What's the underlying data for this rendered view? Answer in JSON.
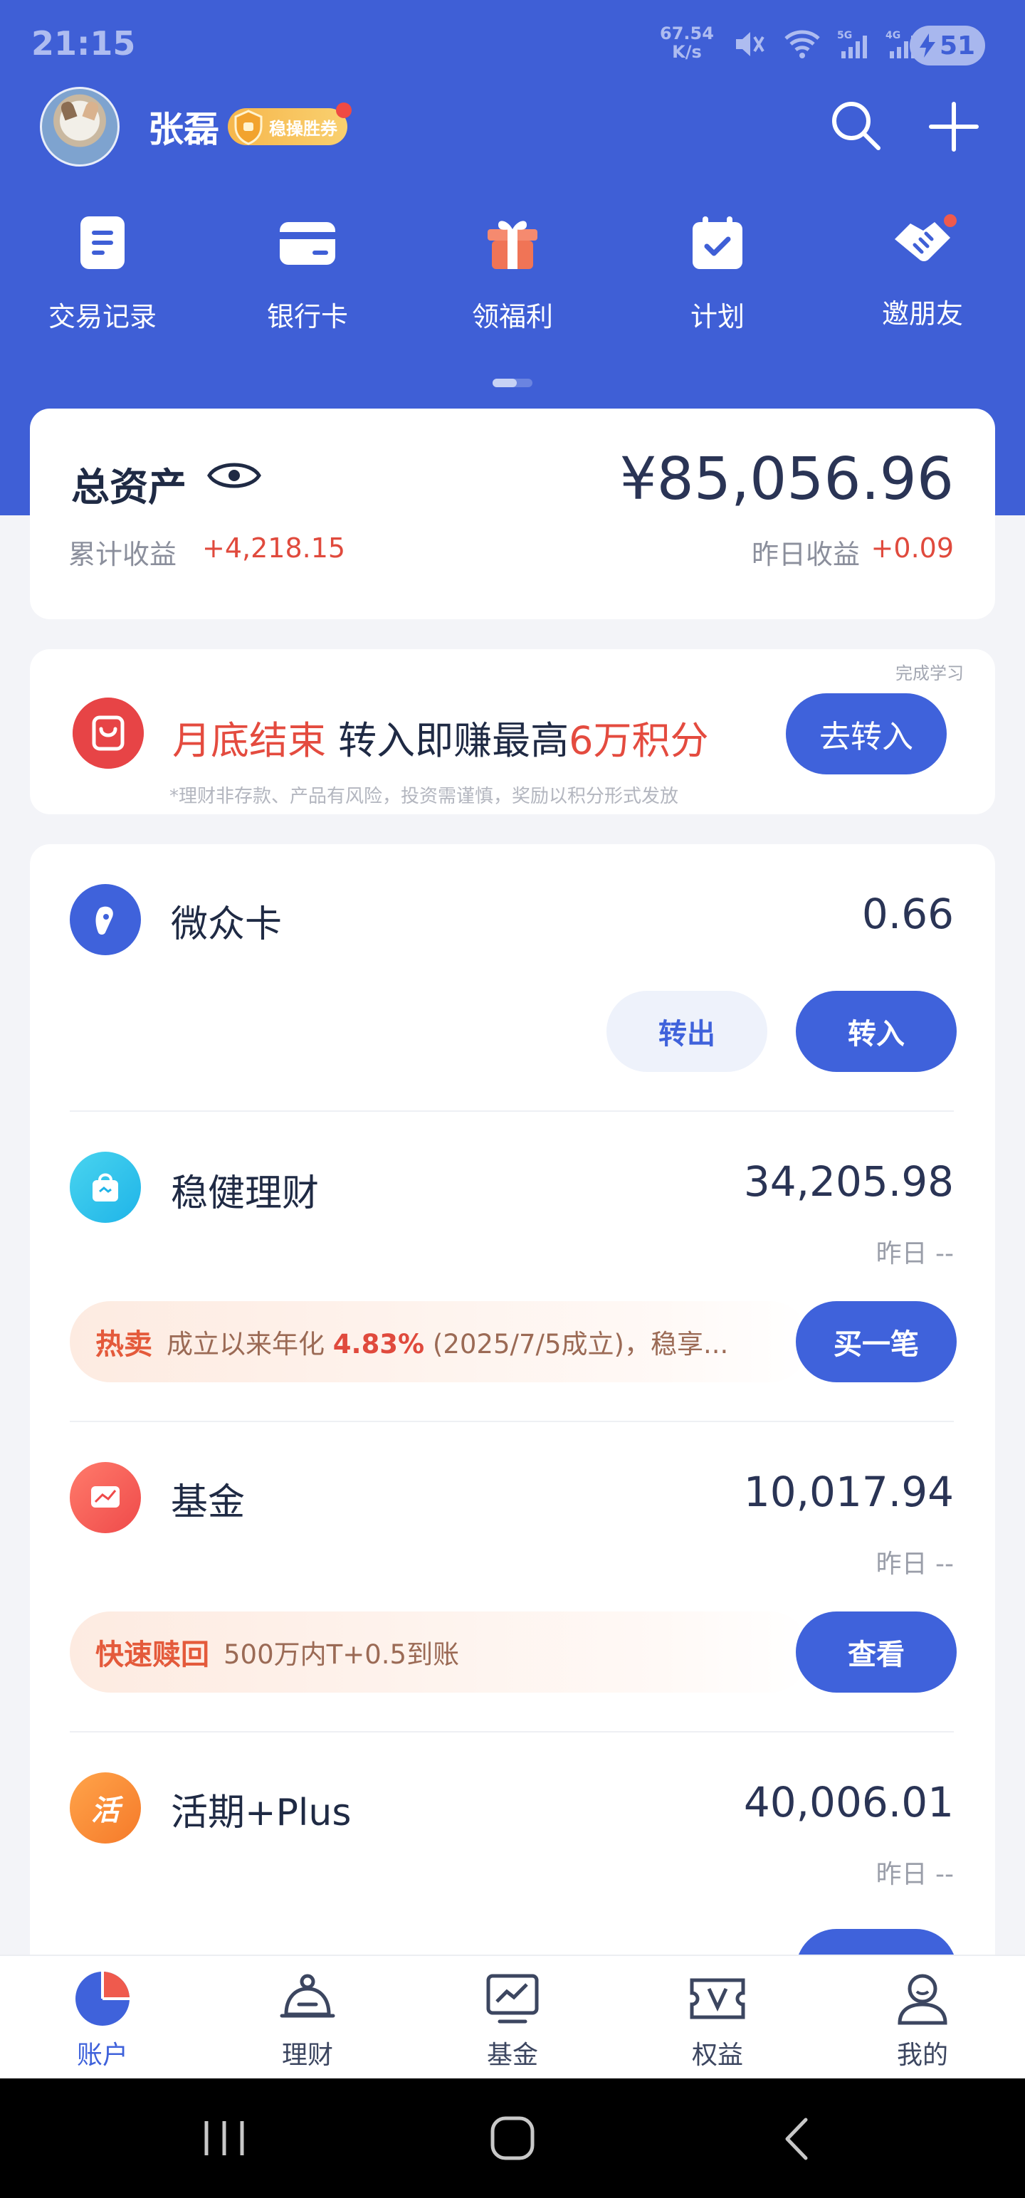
{
  "status_bar": {
    "time": "21:15",
    "net_speed_value": "67.54",
    "net_speed_unit": "K/s",
    "battery": "51"
  },
  "header": {
    "user_name": "张磊",
    "badge_label": "稳操胜券"
  },
  "quick_menu": [
    {
      "label": "交易记录",
      "icon": "document-icon"
    },
    {
      "label": "银行卡",
      "icon": "card-icon"
    },
    {
      "label": "领福利",
      "icon": "gift-icon"
    },
    {
      "label": "计划",
      "icon": "calendar-icon"
    },
    {
      "label": "邀朋友",
      "icon": "handshake-icon"
    }
  ],
  "assets": {
    "title": "总资产",
    "total": "¥85,056.96",
    "cumulative_label": "累计收益",
    "cumulative_value": "+4,218.15",
    "yesterday_label": "昨日收益",
    "yesterday_value": "+0.09"
  },
  "promo": {
    "done_label": "完成学习",
    "red_1": "月底结束",
    "text_mid": " 转入即赚最高",
    "red_2": "6万积分",
    "button": "去转入",
    "note": "*理财非存款、产品有风险，投资需谨慎，奖励以积分形式发放"
  },
  "products": {
    "weizhong": {
      "name": "微众卡",
      "value": "0.66",
      "out_label": "转出",
      "in_label": "转入"
    },
    "wenjian": {
      "name": "稳健理财",
      "value": "34,205.98",
      "yesterday": "昨日 --",
      "tag": "热卖",
      "text_1": "成立以来年化 ",
      "rate": "4.83%",
      "text_2": " (2025/7/5成立)，稳享...",
      "button": "买一笔"
    },
    "fund": {
      "name": "基金",
      "value": "10,017.94",
      "yesterday": "昨日 --",
      "tag": "快速赎回",
      "text": "500万内T+0.5到账",
      "button": "查看"
    },
    "huoqi": {
      "name": "活期+Plus",
      "value": "40,006.01",
      "yesterday": "昨日 --",
      "icon_char": "活"
    }
  },
  "tabs": [
    {
      "label": "账户",
      "active": true
    },
    {
      "label": "理财",
      "active": false
    },
    {
      "label": "基金",
      "active": false
    },
    {
      "label": "权益",
      "active": false
    },
    {
      "label": "我的",
      "active": false
    }
  ],
  "colors": {
    "primary": "#3f5fd6",
    "accent_red": "#e04a3d",
    "button_blue": "#3f62db"
  }
}
